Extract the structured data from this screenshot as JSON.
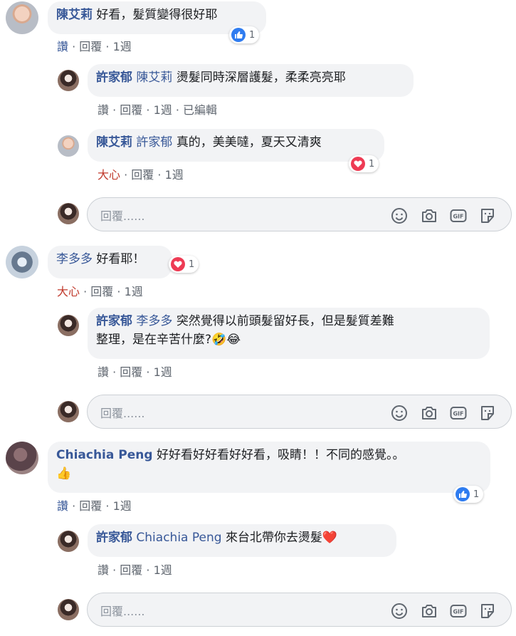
{
  "comments": [
    {
      "author": "陳艾莉",
      "text": "好看，髮質變得很好耶",
      "actions": {
        "like": "讚",
        "reply": "回覆",
        "time": "1週"
      },
      "reaction": {
        "type": "like-icon",
        "count": "1"
      },
      "replies": [
        {
          "author": "許家郁",
          "mention": "陳艾莉",
          "text": "燙髮同時深層護髮，柔柔亮亮耶",
          "actions": {
            "like": "讚",
            "reply": "回覆",
            "time": "1週",
            "edited": "已編輯"
          }
        },
        {
          "author": "陳艾莉",
          "mention": "許家郁",
          "text": "真的，美美噠，夏天又清爽",
          "actions": {
            "love": "大心",
            "reply": "回覆",
            "time": "1週"
          },
          "reaction": {
            "type": "love-icon",
            "count": "1"
          }
        }
      ]
    },
    {
      "author": "李多多",
      "text": "好看耶！",
      "actions": {
        "love": "大心",
        "reply": "回覆",
        "time": "1週"
      },
      "reaction": {
        "type": "love-icon",
        "count": "1"
      },
      "replies": [
        {
          "author": "許家郁",
          "mention": "李多多",
          "text_line1": "突然覺得以前頭髮留好長，但是髮質差難",
          "text_line2": "整理，是在辛苦什麼?🤣😂",
          "actions": {
            "like": "讚",
            "reply": "回覆",
            "time": "1週"
          }
        }
      ]
    },
    {
      "author": "Chiachia Peng",
      "text_line1": "好好看好好看好好看，吸睛！！不同的感覺。。",
      "text_line2": "👍",
      "actions": {
        "like": "讚",
        "reply": "回覆",
        "time": "1週"
      },
      "reaction": {
        "type": "like-icon",
        "count": "1"
      },
      "replies": [
        {
          "author": "許家郁",
          "mention": "Chiachia Peng",
          "text": "來台北帶你去燙髮❤️",
          "actions": {
            "like": "讚",
            "reply": "回覆",
            "time": "1週"
          }
        }
      ]
    }
  ],
  "reply_box": {
    "placeholder": "回覆......"
  },
  "icons": [
    "emoji-icon",
    "camera-icon",
    "gif-icon",
    "sticker-icon"
  ],
  "colors": {
    "link": "#385898",
    "bubble": "#f2f3f5",
    "like": "#2f7cf0",
    "love": "#ee3b54"
  }
}
